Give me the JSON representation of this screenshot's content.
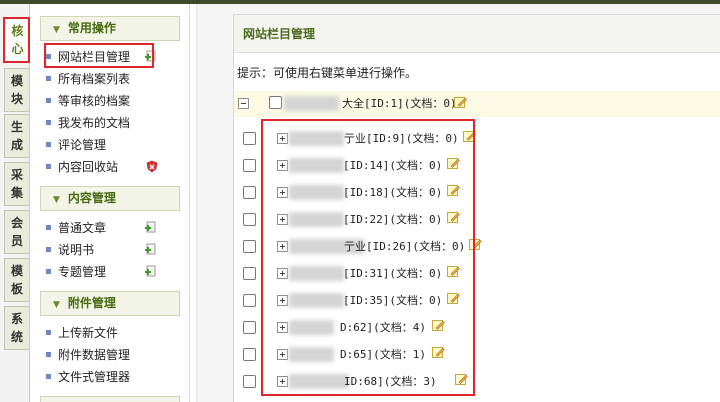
{
  "tabs": [
    {
      "label_top": "核",
      "label_bottom": "心",
      "active": true
    },
    {
      "label_top": "模",
      "label_bottom": "块",
      "active": false
    },
    {
      "label_top": "生",
      "label_bottom": "成",
      "active": false
    },
    {
      "label_top": "采",
      "label_bottom": "集",
      "active": false
    },
    {
      "label_top": "会",
      "label_bottom": "员",
      "active": false
    },
    {
      "label_top": "模",
      "label_bottom": "板",
      "active": false
    },
    {
      "label_top": "系",
      "label_bottom": "统",
      "active": false
    }
  ],
  "sidebar": {
    "sections": [
      {
        "title": "常用操作",
        "items": [
          {
            "label": "网站栏目管理",
            "icon": "plus-icon"
          },
          {
            "label": "所有档案列表",
            "icon": ""
          },
          {
            "label": "等审核的档案",
            "icon": ""
          },
          {
            "label": "我发布的文档",
            "icon": ""
          },
          {
            "label": "评论管理",
            "icon": ""
          },
          {
            "label": "内容回收站",
            "icon": "shield-icon"
          }
        ]
      },
      {
        "title": "内容管理",
        "items": [
          {
            "label": "普通文章",
            "icon": "plus-icon"
          },
          {
            "label": "说明书",
            "icon": "plus-icon"
          },
          {
            "label": "专题管理",
            "icon": "plus-icon"
          }
        ]
      },
      {
        "title": "附件管理",
        "items": [
          {
            "label": "上传新文件",
            "icon": ""
          },
          {
            "label": "附件数据管理",
            "icon": ""
          },
          {
            "label": "文件式管理器",
            "icon": ""
          }
        ]
      }
    ]
  },
  "main": {
    "title": "网站栏目管理",
    "hint": "提示：可使用右键菜单进行操作。",
    "top_row": {
      "label": "大全[ID:1](文档：0)"
    },
    "rows": [
      {
        "label": "亍业[ID:9](文档：0)"
      },
      {
        "label": "[ID:14](文档：0)"
      },
      {
        "label": "[ID:18](文档：0)"
      },
      {
        "label": "[ID:22](文档：0)"
      },
      {
        "label": "亍业[ID:26](文档：0)"
      },
      {
        "label": "[ID:31](文档：0)"
      },
      {
        "label": "[ID:35](文档：0)"
      },
      {
        "label": "D:62](文档：4)"
      },
      {
        "label": "D:65](文档：1)"
      },
      {
        "label": "ID:68](文档：3)"
      }
    ]
  },
  "colors": {
    "accent_green": "#4b6a1f",
    "highlight_red": "#e0262a",
    "section_bg": "#f1f4e6",
    "top_row_bg": "#fcf9e4"
  }
}
